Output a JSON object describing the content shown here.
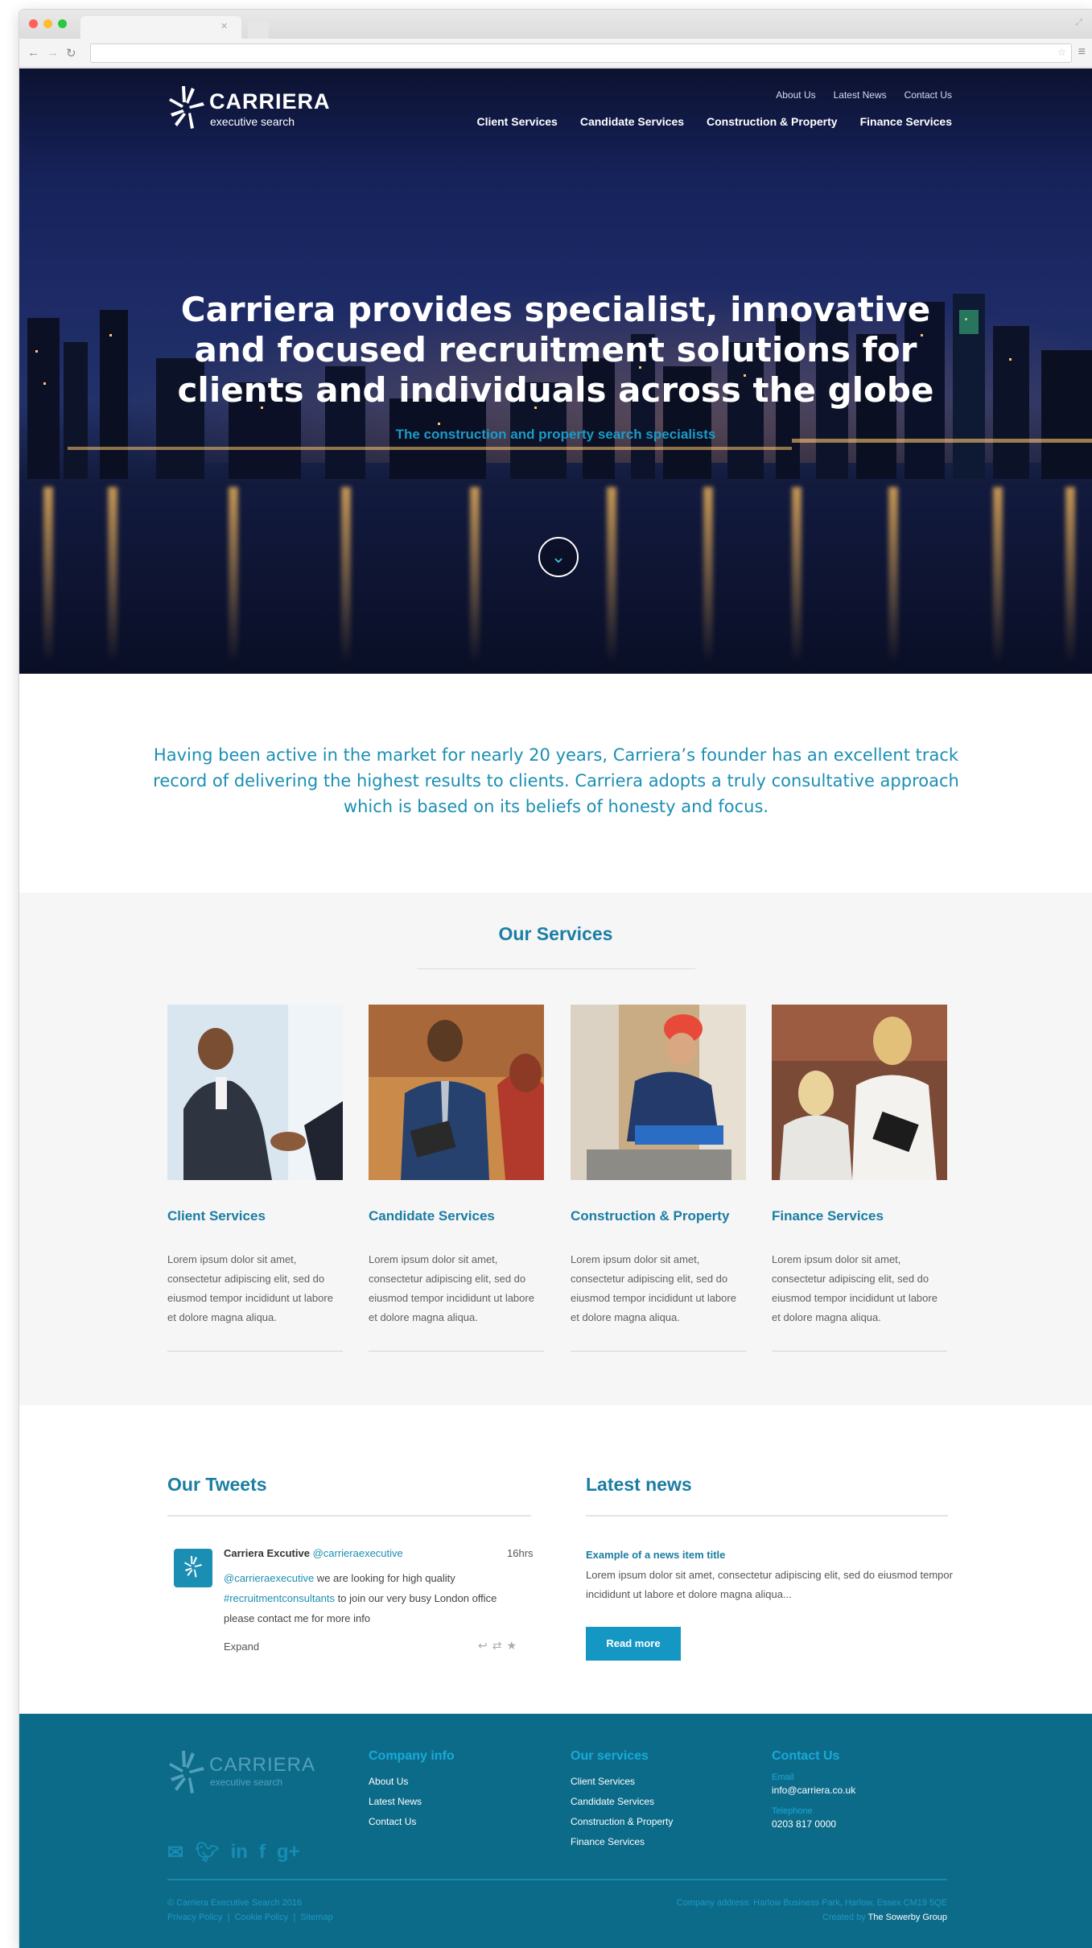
{
  "brand": {
    "name": "CARRIERA",
    "tagline": "executive search"
  },
  "nav": {
    "top": [
      "About Us",
      "Latest News",
      "Contact Us"
    ],
    "main": [
      "Client Services",
      "Candidate Services",
      "Construction & Property",
      "Finance Services"
    ]
  },
  "hero": {
    "title_line1": "Carriera provides specialist, innovative",
    "title_line2": "and focused recruitment solutions for",
    "title_line3": "clients and individuals across the globe",
    "subtitle": "The construction and property search specialists"
  },
  "intro": {
    "text": "Having been active in the market for nearly 20 years, Carriera’s founder has an excellent track record of delivering the highest results to clients. Carriera adopts a truly consultative approach which is based on its beliefs of honesty and focus."
  },
  "services": {
    "title": "Our Services",
    "items": [
      {
        "title": "Client Services",
        "text": "Lorem ipsum dolor sit amet, consectetur adipiscing elit, sed do eiusmod tempor incididunt ut labore et dolore magna aliqua."
      },
      {
        "title": "Candidate Services",
        "text": "Lorem ipsum dolor sit amet, consectetur adipiscing elit, sed do eiusmod tempor incididunt ut labore et dolore magna aliqua."
      },
      {
        "title": "Construction & Property",
        "text": "Lorem ipsum dolor sit amet, consectetur adipiscing elit, sed do eiusmod tempor incididunt ut labore et dolore magna aliqua."
      },
      {
        "title": "Finance Services",
        "text": "Lorem ipsum dolor sit amet, consectetur adipiscing elit, sed do eiusmod tempor incididunt ut labore et dolore magna aliqua."
      }
    ]
  },
  "tweets": {
    "title": "Our Tweets",
    "name": "Carriera Excutive",
    "handle": "@carrieraexecutive",
    "time": "16hrs",
    "mention": "@carrieraexecutive",
    "text1": " we are looking for high quality",
    "hashtag": "#recruitmentconsultants",
    "text2": " to join our very busy London office please contact me for more info",
    "expand": "Expand"
  },
  "news": {
    "title": "Latest news",
    "item_title": "Example of a news item title",
    "item_text": "Lorem ipsum dolor sit amet, consectetur adipiscing elit, sed do eiusmod tempor incididunt ut labore et dolore magna aliqua...",
    "button": "Read more"
  },
  "footer": {
    "company_head": "Company info",
    "company_links": [
      "About Us",
      "Latest News",
      "Contact Us"
    ],
    "services_head": "Our services",
    "services_links": [
      "Client Services",
      "Candidate Services",
      "Construction & Property",
      "Finance Services"
    ],
    "contact_head": "Contact Us",
    "email_label": "Email",
    "email": "info@carriera.co.uk",
    "phone_label": "Telephone",
    "phone": "0203 817 0000",
    "copyright": "© Carriera Executive Search 2016",
    "legal_links": [
      "Privacy Policy",
      "Cookie Policy",
      "Sitemap"
    ],
    "address": "Company address: Harlow Business Park, Harlow, Essex CM19 5QE",
    "created_by": "Created by",
    "agency": "The Sowerby Group"
  },
  "colors": {
    "accent": "#1b8fb3",
    "footer_bg": "#0d6b8a",
    "button": "#1597c3"
  }
}
